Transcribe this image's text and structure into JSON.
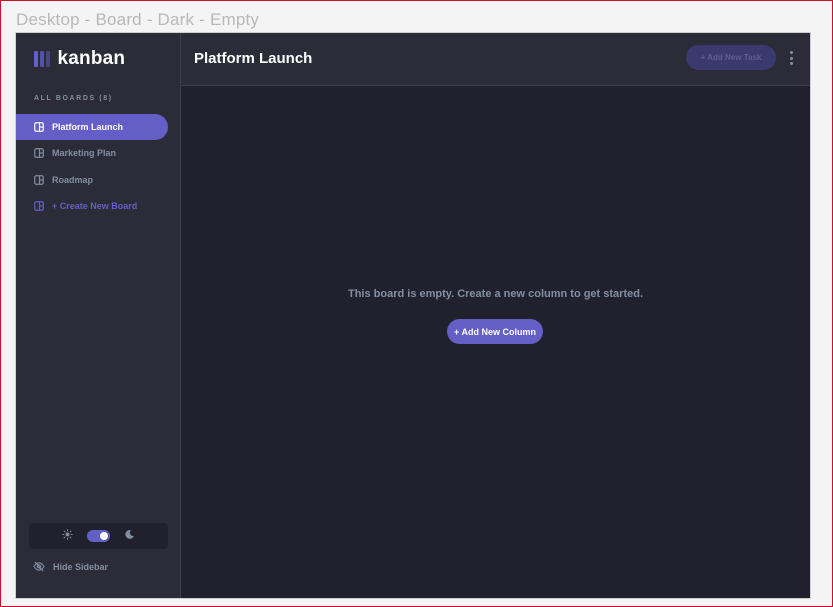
{
  "frame_title": "Desktop - Board - Dark - Empty",
  "logo": {
    "text": "kanban",
    "icon": "kanban-logo-icon"
  },
  "sidebar": {
    "heading": "ALL BOARDS (8)",
    "boards": [
      {
        "label": "Platform Launch",
        "icon": "board-icon",
        "active": true
      },
      {
        "label": "Marketing Plan",
        "icon": "board-icon",
        "active": false
      },
      {
        "label": "Roadmap",
        "icon": "board-icon",
        "active": false
      }
    ],
    "create_board": "+ Create New Board",
    "theme": {
      "light_icon": "sun-icon",
      "dark_icon": "moon-icon",
      "mode": "dark"
    },
    "hide_sidebar": "Hide Sidebar"
  },
  "header": {
    "board_title": "Platform Launch",
    "add_task": "+ Add New Task",
    "menu_icon": "vertical-ellipsis-icon"
  },
  "main": {
    "empty_message": "This board is empty. Create a new column to get started.",
    "add_column": "+ Add New Column"
  },
  "colors": {
    "accent": "#635FC7",
    "background": "#20212C",
    "panel": "#2B2C37",
    "muted_text": "#828FA3",
    "frame_border": "#C8102E"
  }
}
